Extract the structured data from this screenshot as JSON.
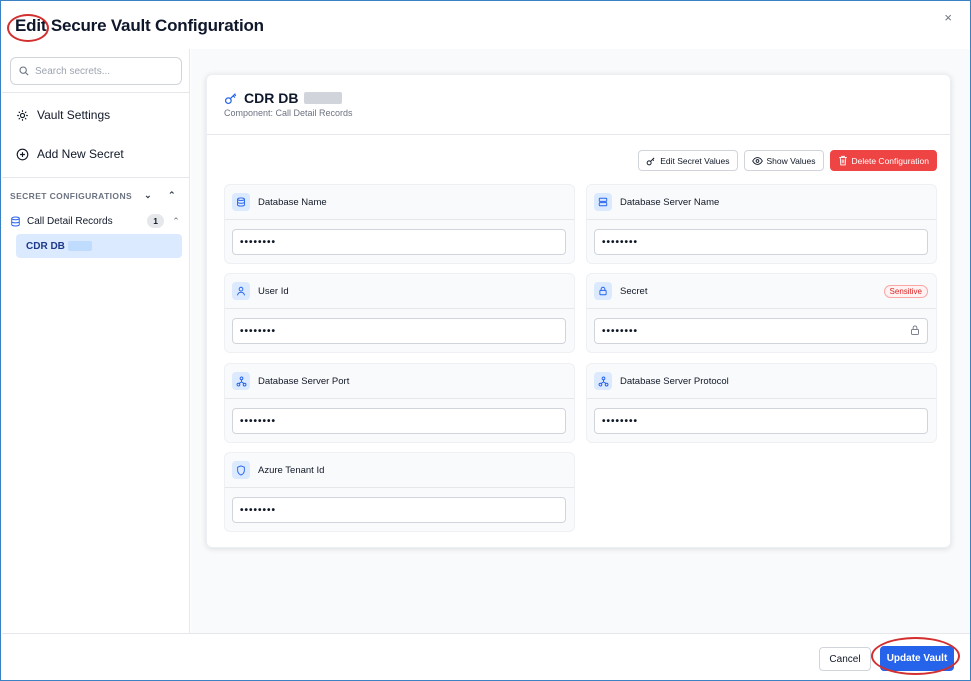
{
  "dialog": {
    "title_prefix": "Edit",
    "title_rest": " Secure Vault Configuration",
    "close_glyph": "×"
  },
  "sidebar": {
    "search_placeholder": "Search secrets...",
    "vault_settings_label": "Vault Settings",
    "add_secret_label": "Add New Secret",
    "section_label": "SECRET CONFIGURATIONS",
    "group": {
      "label": "Call Detail Records",
      "count": "1"
    },
    "selected_item": "CDR DB"
  },
  "card": {
    "title": "CDR DB",
    "subtitle": "Component: Call Detail Records",
    "actions": {
      "edit_label": "Edit Secret Values",
      "show_label": "Show Values",
      "delete_label": "Delete Configuration"
    }
  },
  "fields": [
    {
      "label": "Database Name",
      "value": "••••••••",
      "icon": "database-icon"
    },
    {
      "label": "Database Server Name",
      "value": "••••••••",
      "icon": "server-icon"
    },
    {
      "label": "User Id",
      "value": "••••••••",
      "icon": "user-icon"
    },
    {
      "label": "Secret",
      "value": "••••••••",
      "icon": "lock-icon",
      "badge": "Sensitive"
    },
    {
      "label": "Database Server Port",
      "value": "••••••••",
      "icon": "network-icon"
    },
    {
      "label": "Database Server Protocol",
      "value": "••••••••",
      "icon": "network-icon"
    },
    {
      "label": "Azure Tenant Id",
      "value": "••••••••",
      "icon": "shield-icon"
    }
  ],
  "footer": {
    "cancel_label": "Cancel",
    "update_label": "Update Vault"
  },
  "colors": {
    "accent": "#2563eb",
    "danger": "#ef4444",
    "selected_bg": "#dbeafe",
    "annotation": "#d32f2f"
  }
}
